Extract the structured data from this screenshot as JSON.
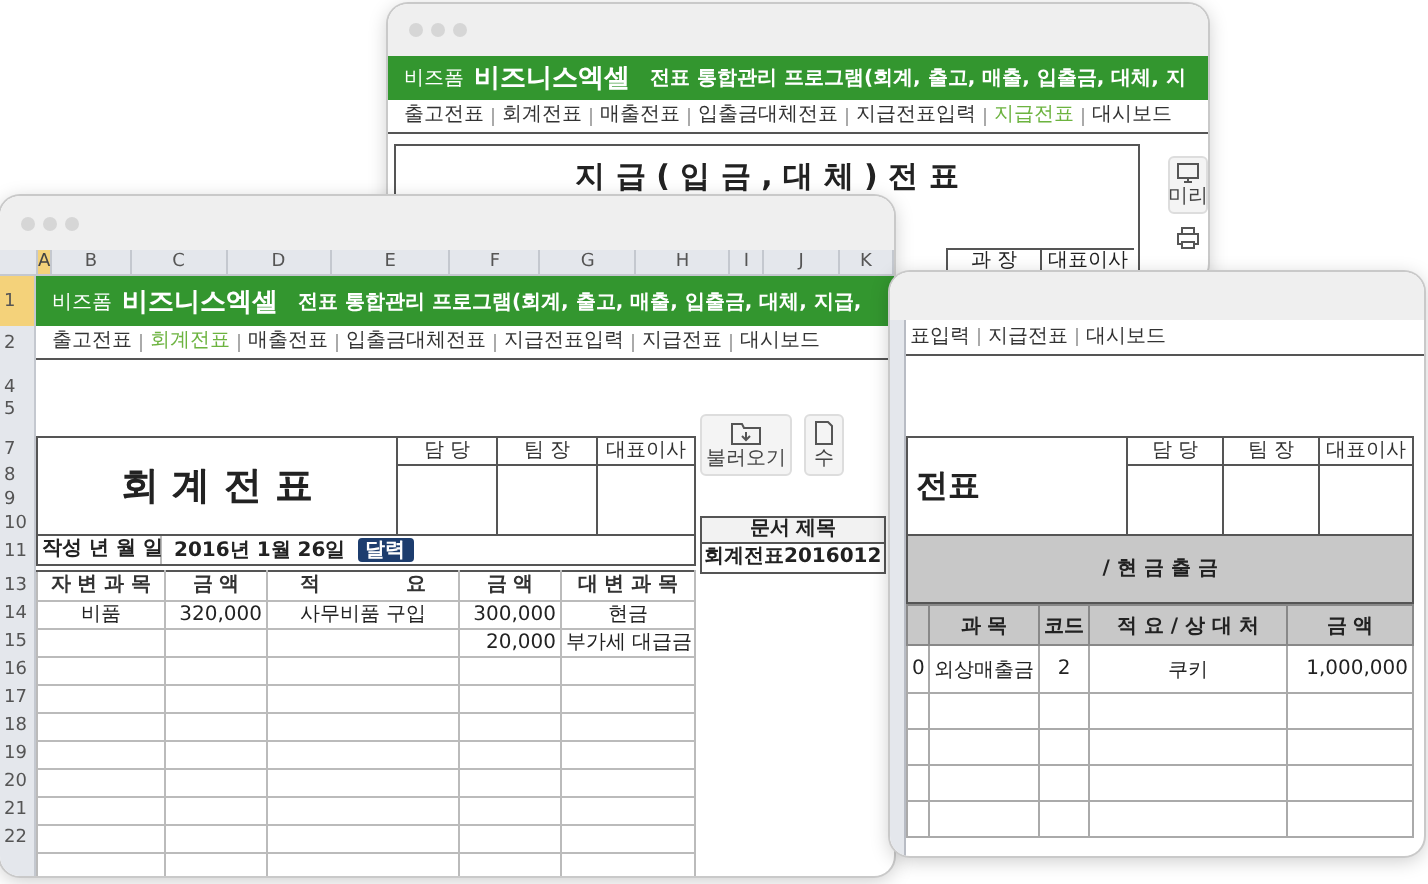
{
  "back_window": {
    "brand_small": "비즈폼",
    "brand": "비즈니스엑셀",
    "program_title": "전표 통합관리 프로그램(회계, 출고, 매출, 입출금, 대체, 지",
    "nav": [
      {
        "label": "출고전표",
        "selected": false
      },
      {
        "label": "회계전표",
        "selected": false
      },
      {
        "label": "매출전표",
        "selected": false
      },
      {
        "label": "입출금대체전표",
        "selected": false
      },
      {
        "label": "지급전표입력",
        "selected": false
      },
      {
        "label": "지급전표",
        "selected": true
      },
      {
        "label": "대시보드",
        "selected": false
      }
    ],
    "form_title": "지 급 ( 입 금 , 대 체 ) 전 표",
    "approval_headers": [
      "과 장",
      "대표이사"
    ],
    "side_button": "미리"
  },
  "front_window": {
    "column_headers": [
      {
        "label": "A",
        "selected": true
      },
      {
        "label": "B",
        "selected": false
      },
      {
        "label": "C",
        "selected": false
      },
      {
        "label": "D",
        "selected": false
      },
      {
        "label": "E",
        "selected": false
      },
      {
        "label": "F",
        "selected": false
      },
      {
        "label": "G",
        "selected": false
      },
      {
        "label": "H",
        "selected": false
      },
      {
        "label": "I",
        "selected": false
      },
      {
        "label": "J",
        "selected": false
      },
      {
        "label": "K",
        "selected": false
      }
    ],
    "row_numbers": [
      {
        "label": "1",
        "selected": true
      },
      {
        "label": "2",
        "selected": false
      },
      {
        "label": "4",
        "selected": false
      },
      {
        "label": "5",
        "selected": false
      },
      {
        "label": "7",
        "selected": false
      },
      {
        "label": "8",
        "selected": false
      },
      {
        "label": "9",
        "selected": false
      },
      {
        "label": "10",
        "selected": false
      },
      {
        "label": "11",
        "selected": false
      },
      {
        "label": "13",
        "selected": false
      },
      {
        "label": "14",
        "selected": false
      },
      {
        "label": "15",
        "selected": false
      },
      {
        "label": "16",
        "selected": false
      },
      {
        "label": "17",
        "selected": false
      },
      {
        "label": "18",
        "selected": false
      },
      {
        "label": "19",
        "selected": false
      },
      {
        "label": "20",
        "selected": false
      },
      {
        "label": "21",
        "selected": false
      },
      {
        "label": "22",
        "selected": false
      }
    ],
    "brand_small": "비즈폼",
    "brand": "비즈니스엑셀",
    "program_title": "전표 통합관리 프로그램(회계, 출고, 매출, 입출금, 대체, 지급,",
    "nav": [
      {
        "label": "출고전표",
        "selected": false
      },
      {
        "label": "회계전표",
        "selected": true
      },
      {
        "label": "매출전표",
        "selected": false
      },
      {
        "label": "입출금대체전표",
        "selected": false
      },
      {
        "label": "지급전표입력",
        "selected": false
      },
      {
        "label": "지급전표",
        "selected": false
      },
      {
        "label": "대시보드",
        "selected": false
      }
    ],
    "side_buttons": [
      "불러오기",
      "수"
    ],
    "form_title": "회 계 전 표",
    "approval_headers": [
      "담 당",
      "팀 장",
      "대표이사"
    ],
    "date_label": "작성 년 월 일",
    "date_value": "2016년 1월 26일",
    "calendar_button": "달력",
    "document_title": {
      "label": "문서 제목",
      "value": "회계전표2016012"
    },
    "table": {
      "columns": [
        {
          "label": "자 변 과 목"
        },
        {
          "label": "금 액"
        },
        {
          "parts": [
            "적",
            "요"
          ]
        },
        {
          "label": "금 액"
        },
        {
          "label": "대 변 과 목"
        }
      ],
      "rows": [
        {
          "debit_account": "비품",
          "debit_amount": "320,000",
          "description": "사무비품 구입",
          "credit_amount": "300,000",
          "credit_account": "현금"
        },
        {
          "credit_amount": "20,000",
          "credit_account": "부가세 대급금"
        }
      ]
    }
  },
  "right_window": {
    "nav": [
      {
        "label": "표입력",
        "selected": false
      },
      {
        "label": "지급전표",
        "selected": false
      },
      {
        "label": "대시보드",
        "selected": false
      }
    ],
    "form_title": "전표",
    "approval_headers": [
      "담 당",
      "팀 장",
      "대표이사"
    ],
    "section_title": "/ 현 금 출 금",
    "table": {
      "columns": [
        "과 목",
        "코드",
        "적 요 / 상 대 처",
        "금 액"
      ],
      "rows": [
        {
          "column_1": "0",
          "account": "외상매출금",
          "code": "2",
          "description": "쿠키",
          "amount": "1,000,000"
        }
      ]
    }
  }
}
